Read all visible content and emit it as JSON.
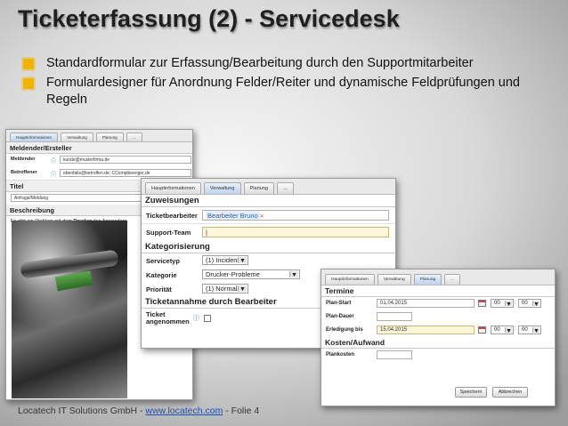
{
  "slide": {
    "title": "Ticketerfassung (2) - Servicedesk",
    "bullets": [
      "Standardformular zur Erfassung/Bearbeitung  durch den Supportmitarbeiter",
      "Formulardesigner für Anordnung Felder/Reiter und dynamische Feldprüfungen und Regeln"
    ],
    "footer_prefix": "Locatech IT Solutions GmbH - ",
    "footer_link": "www.locatech.com",
    "footer_suffix": " - Folie 4",
    "bullet_color": "#f0b400"
  },
  "form1": {
    "tabs": [
      "Hauptinformationen",
      "Verwaltung",
      "Planung",
      "..."
    ],
    "section_requester": "Meldender/Ersteller",
    "label_reporter": "Meldender",
    "reporter_value": "kunde@musterfirma.de",
    "label_affected": "Betroffener",
    "affected_value": "ebenfalls@betroffen.de; CComplbeenger.de",
    "section_title": "Titel",
    "title_value": "Anfrage/Meldung",
    "section_description": "Beschreibung",
    "description_prefix": "Es gibt ein Problem mit dem ",
    "description_bold": "Drucker",
    "description_suffix": " des Anwenders."
  },
  "form2": {
    "tabs": [
      "Hauptinformationen",
      "Verwaltung",
      "Planung",
      "..."
    ],
    "section_assignments": "Zuweisungen",
    "label_agent": "Ticketbearbeiter",
    "agent_value": "Bearbeiter Bruno",
    "label_team": "Support-Team",
    "section_categorization": "Kategorisierung",
    "label_servicetype": "Servicetyp",
    "servicetype_value": "(1) Incident",
    "label_category": "Kategorie",
    "category_value": "Drucker-Probleme",
    "label_priority": "Priorität",
    "priority_value": "(1) Normal",
    "section_acceptance": "Ticketannahme durch Bearbeiter",
    "label_accepted_1": "Ticket",
    "label_accepted_2": "angenommen"
  },
  "form3": {
    "tabs": [
      "Hauptinformationen",
      "Verwaltung",
      "Planung",
      "..."
    ],
    "section_dates": "Termine",
    "label_plan_start": "Plan-Start",
    "plan_start_value": "01.04.2015",
    "plan_start_hour": "00",
    "plan_start_min": "00",
    "label_plan_duration": "Plan-Dauer",
    "label_done_by": "Erledigung bis",
    "done_by_value": "15.04.2015",
    "done_by_hour": "00",
    "done_by_min": "00",
    "section_costs": "Kosten/Aufwand",
    "label_plan_costs": "Plankosten",
    "save_label": "Speichern",
    "cancel_label": "Abbrechen"
  }
}
